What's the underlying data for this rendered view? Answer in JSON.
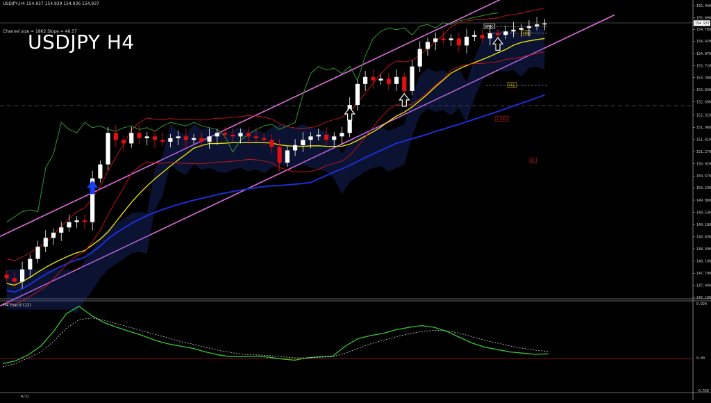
{
  "header": {
    "symbol_line": "USDJPY,H4  154.937 154.939 154.936 154.937",
    "channel_info": "Channel size = 1862 Slope = 46.57",
    "big_title": "USDJPY H4",
    "macd_label": "H4  macd (12)"
  },
  "colors": {
    "background": "#000000",
    "bull_candle": "#ffffff",
    "bear_candle": "#e01010",
    "channel": "#e06ee0",
    "ma_blue": "#1a2fd6",
    "ma_yellow": "#e8e000",
    "envelope_red": "#d01818",
    "ichimoku_green": "#2f9a2f",
    "cloud_blue": "#2a3fb0",
    "cloud_red": "#b02020",
    "macd_main": "#36c936",
    "macd_signal": "#d0d0d0"
  },
  "chart_data": [
    {
      "type": "candlestick",
      "title": "USDJPY H4",
      "ylim": [
        147.1,
        155.44
      ],
      "y_ticks": [
        "155.440",
        "155.090",
        "154.760",
        "154.420",
        "154.070",
        "153.720",
        "153.380",
        "153.030",
        "152.690",
        "152.310",
        "151.960",
        "151.610",
        "151.270",
        "150.920",
        "150.570",
        "150.230",
        "149.880",
        "149.530",
        "149.180",
        "148.830",
        "148.490",
        "148.140",
        "147.790",
        "147.440",
        "147.100"
      ],
      "current_price": "154.937",
      "x_labels": [
        "4/22"
      ],
      "series": [
        {
          "name": "close",
          "values": [
            147.65,
            147.55,
            147.9,
            148.2,
            148.55,
            148.8,
            148.95,
            149.1,
            149.25,
            149.3,
            149.25,
            150.5,
            150.9,
            151.8,
            151.6,
            151.5,
            151.8,
            151.65,
            151.7,
            151.6,
            151.55,
            151.65,
            151.7,
            151.6,
            151.65,
            151.55,
            151.7,
            151.8,
            151.75,
            151.7,
            151.8,
            151.7,
            151.65,
            151.6,
            151.4,
            150.95,
            151.3,
            151.45,
            151.6,
            151.7,
            151.75,
            151.6,
            151.7,
            151.8,
            152.6,
            153.2,
            153.4,
            153.3,
            153.35,
            153.2,
            153.4,
            153.0,
            153.7,
            154.2,
            154.4,
            154.5,
            154.45,
            154.5,
            154.3,
            154.55,
            154.6,
            154.5,
            154.65,
            154.6,
            154.7,
            154.75,
            154.8,
            154.85,
            154.9,
            154.93
          ]
        }
      ],
      "levels": [
        {
          "label": "VPOC",
          "value": 154.84
        },
        {
          "label": "VAH",
          "value": 154.65
        },
        {
          "label": "VAL",
          "value": 153.16
        },
        {
          "label": "1.56%",
          "value": 152.2
        },
        {
          "label": "R1",
          "value": 151.0
        }
      ],
      "arrows": [
        {
          "direction": "up",
          "style": "filled",
          "x_index": 11
        },
        {
          "direction": "up",
          "style": "outline",
          "x_index": 44
        },
        {
          "direction": "up",
          "style": "outline",
          "x_index": 51
        },
        {
          "direction": "up",
          "style": "outline",
          "x_index": 63
        }
      ]
    },
    {
      "type": "line",
      "title": "H4  macd (12)",
      "ylim": [
        -0.556,
        0.924
      ],
      "y_ticks": [
        "0.924",
        "0.00",
        "-0.556"
      ],
      "series": [
        {
          "name": "macd",
          "values": [
            -0.1,
            -0.05,
            0.05,
            0.2,
            0.45,
            0.75,
            0.88,
            0.72,
            0.6,
            0.52,
            0.45,
            0.38,
            0.3,
            0.24,
            0.2,
            0.16,
            0.1,
            0.05,
            0.02,
            0.02,
            0.03,
            0.01,
            -0.02,
            -0.04,
            0.0,
            0.02,
            0.03,
            0.2,
            0.33,
            0.38,
            0.42,
            0.48,
            0.52,
            0.55,
            0.52,
            0.45,
            0.35,
            0.25,
            0.18,
            0.14,
            0.1,
            0.08,
            0.06,
            0.07
          ]
        },
        {
          "name": "signal",
          "values": [
            -0.15,
            -0.1,
            0.0,
            0.1,
            0.28,
            0.5,
            0.65,
            0.68,
            0.64,
            0.58,
            0.52,
            0.46,
            0.4,
            0.34,
            0.28,
            0.23,
            0.18,
            0.13,
            0.09,
            0.06,
            0.05,
            0.04,
            0.02,
            0.0,
            0.0,
            0.01,
            0.02,
            0.08,
            0.16,
            0.24,
            0.3,
            0.36,
            0.41,
            0.45,
            0.47,
            0.46,
            0.42,
            0.36,
            0.3,
            0.25,
            0.2,
            0.16,
            0.13,
            0.11
          ]
        }
      ]
    }
  ]
}
